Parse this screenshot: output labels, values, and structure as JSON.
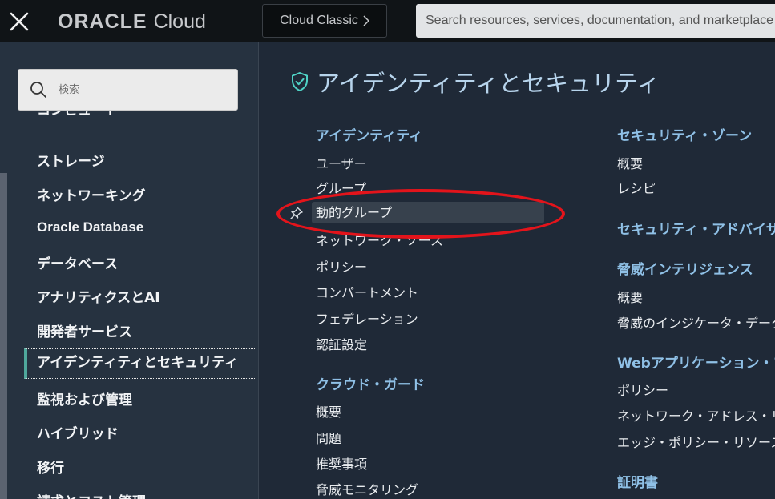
{
  "topbar": {
    "brand_oracle": "ORACLE",
    "brand_cloud": "Cloud",
    "classic_button": "Cloud Classic",
    "search_placeholder": "Search resources, services, documentation, and marketplace"
  },
  "sidebar": {
    "search_placeholder": "検索",
    "items": [
      {
        "label": "コンピュート"
      },
      {
        "label": "ストレージ"
      },
      {
        "label": "ネットワーキング"
      },
      {
        "label": "Oracle Database"
      },
      {
        "label": "データベース"
      },
      {
        "label": "アナリティクスとAI"
      },
      {
        "label": "開発者サービス"
      },
      {
        "label": "アイデンティティとセキュリティ"
      },
      {
        "label": "監視および管理"
      },
      {
        "label": "ハイブリッド"
      },
      {
        "label": "移行"
      },
      {
        "label": "請求とコスト管理"
      }
    ]
  },
  "main": {
    "title": "アイデンティティとセキュリティ",
    "col1": {
      "identity": {
        "heading": "アイデンティティ",
        "links": [
          "ユーザー",
          "グループ",
          "動的グループ",
          "ネットワーク・ソース",
          "ポリシー",
          "コンパートメント",
          "フェデレーション",
          "認証設定"
        ]
      },
      "cloud_guard": {
        "heading": "クラウド・ガード",
        "links": [
          "概要",
          "問題",
          "推奨事項",
          "脅威モニタリング"
        ]
      }
    },
    "col2": {
      "security_zones": {
        "heading": "セキュリティ・ゾーン",
        "links": [
          "概要",
          "レシピ"
        ]
      },
      "security_advisor": {
        "heading": "セキュリティ・アドバイザ"
      },
      "threat_intel": {
        "heading": "脅威インテリジェンス",
        "links": [
          "概要",
          "脅威のインジケータ・データ"
        ]
      },
      "waf": {
        "heading": "Webアプリケーション・ファイアウォール",
        "links": [
          "ポリシー",
          "ネットワーク・アドレス・リスト",
          "エッジ・ポリシー・リソース"
        ]
      },
      "certificates": {
        "heading": "証明書"
      }
    }
  },
  "colors": {
    "accent": "#4fa89c",
    "heading_blue": "#8fc0e6",
    "annotation_red": "#e3141b"
  }
}
